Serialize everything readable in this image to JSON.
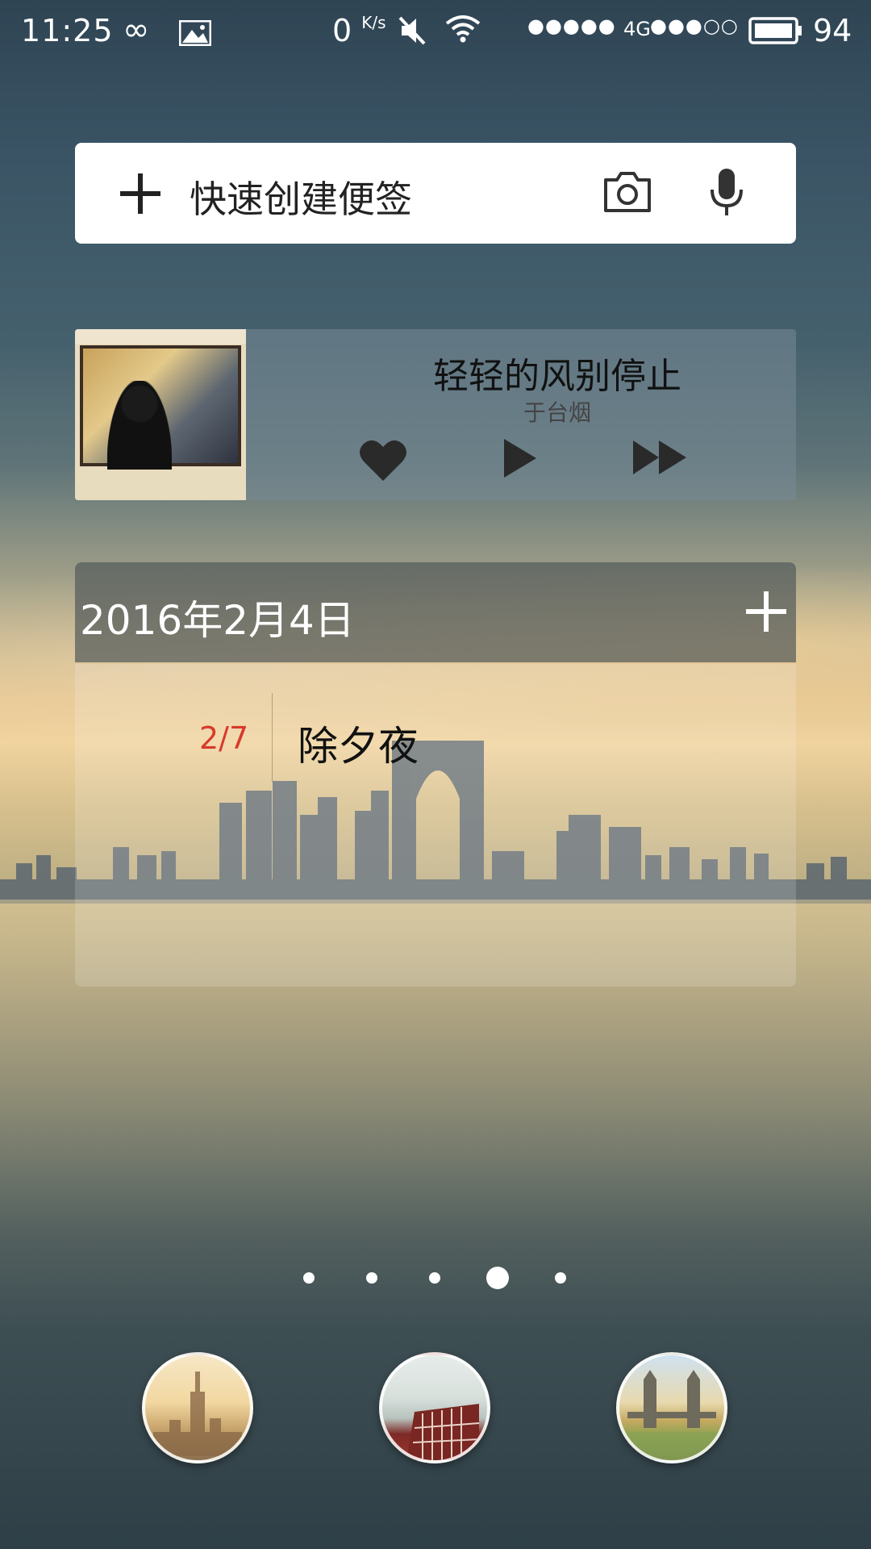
{
  "status_bar": {
    "time": "11:25",
    "speed_value": "0",
    "speed_unit": "K/s",
    "signal_sim1": "●●●●●",
    "network_type": "4G",
    "signal_sim2": "●●●○○",
    "battery": "94"
  },
  "quick_note": {
    "label": "快速创建便签"
  },
  "music": {
    "title": "轻轻的风别停止",
    "artist": "于台烟"
  },
  "calendar": {
    "date": "2016年2月4日",
    "events": [
      {
        "date": "2/7",
        "title": "除夕夜"
      }
    ]
  },
  "page_indicator": {
    "count": 5,
    "active_index": 3
  },
  "colors": {
    "event_date": "#d73a2c",
    "widget_bg": "#ffffff"
  },
  "icons": [
    "infinity-icon",
    "image-icon",
    "mute-icon",
    "wifi-icon",
    "battery-icon",
    "plus-icon",
    "camera-icon",
    "mic-icon",
    "heart-icon",
    "play-icon",
    "next-icon",
    "add-icon"
  ]
}
